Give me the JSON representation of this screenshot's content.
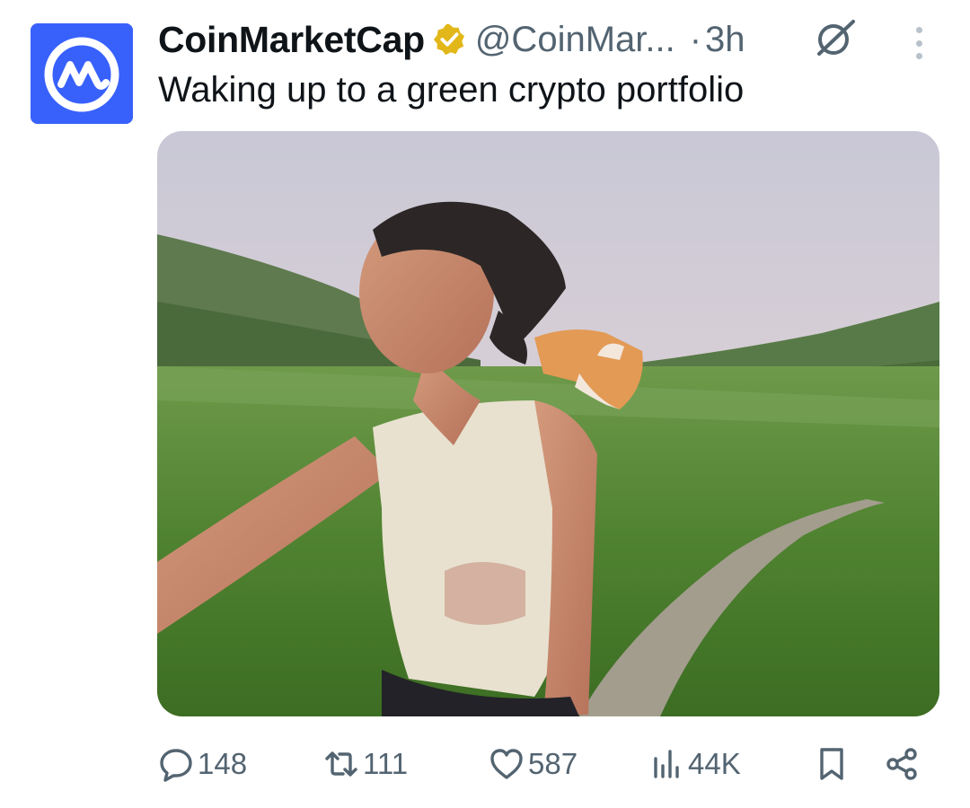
{
  "tweet": {
    "author_name": "CoinMarketCap",
    "handle": "@CoinMar...",
    "separator": "·",
    "time": "3h",
    "text": "Waking up to a green crypto portfolio"
  },
  "media": {
    "type": "video",
    "muted": true
  },
  "actions": {
    "replies": "148",
    "reposts": "111",
    "likes": "587",
    "views": "44K"
  },
  "icons": {
    "avatar": "coinmarketcap-logo",
    "verified": "gold-verified-badge",
    "grok": "grok-icon",
    "more": "more-vertical-icon",
    "mute": "volume-muted-icon",
    "reply": "reply-icon",
    "repost": "repost-icon",
    "like": "heart-icon",
    "views": "views-icon",
    "bookmark": "bookmark-icon",
    "share": "share-icon"
  },
  "colors": {
    "brand": "#3861fb",
    "verified_gold": "#e2b719",
    "secondary_text": "#536471",
    "primary_text": "#0f1419"
  }
}
